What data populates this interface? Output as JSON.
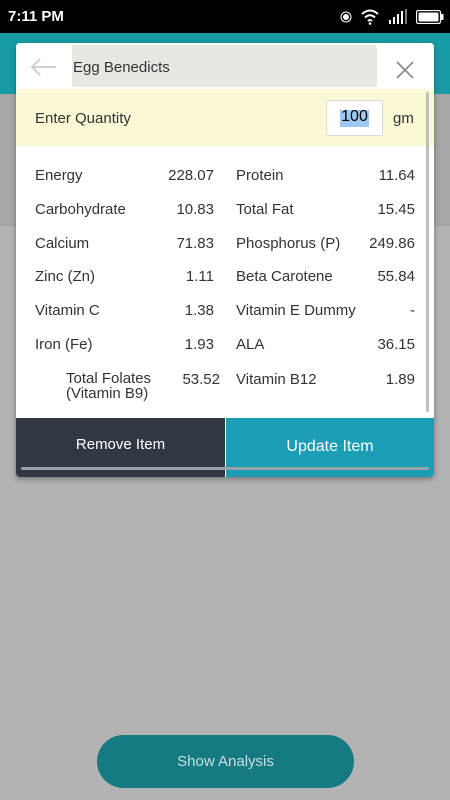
{
  "status_bar": {
    "time": "7:11 PM"
  },
  "dialog": {
    "item_name": "Egg Benedicts",
    "quantity_label": "Enter Quantity",
    "quantity_value": "100",
    "quantity_unit": "gm",
    "nutrients": [
      {
        "name1": "Energy",
        "value1": "228.07",
        "name2": "Protein",
        "value2": "11.64"
      },
      {
        "name1": "Carbohydrate",
        "value1": "10.83",
        "name2": "Total Fat",
        "value2": "15.45"
      },
      {
        "name1": "Calcium",
        "value1": "71.83",
        "name2": "Phosphorus (P)",
        "value2": "249.86"
      },
      {
        "name1": "Zinc (Zn)",
        "value1": "1.11",
        "name2": "Beta Carotene",
        "value2": "55.84"
      },
      {
        "name1": "Vitamin C",
        "value1": "1.38",
        "name2": "Vitamin E Dummy",
        "value2": "-"
      },
      {
        "name1": "Iron (Fe)",
        "value1": "1.93",
        "name2": "ALA",
        "value2": "36.15"
      },
      {
        "name1": "Total Folates (Vitamin B9)",
        "value1": "53.52",
        "name2": "Vitamin B12",
        "value2": "1.89"
      }
    ],
    "remove_label": "Remove Item",
    "update_label": "Update Item"
  },
  "show_analysis_label": "Show Analysis",
  "colors": {
    "header_teal": "#179ca6",
    "remove_button": "#323744",
    "update_button": "#1a9db5",
    "analysis_button": "#157a82",
    "quantity_row_bg": "#fbf8d6"
  }
}
